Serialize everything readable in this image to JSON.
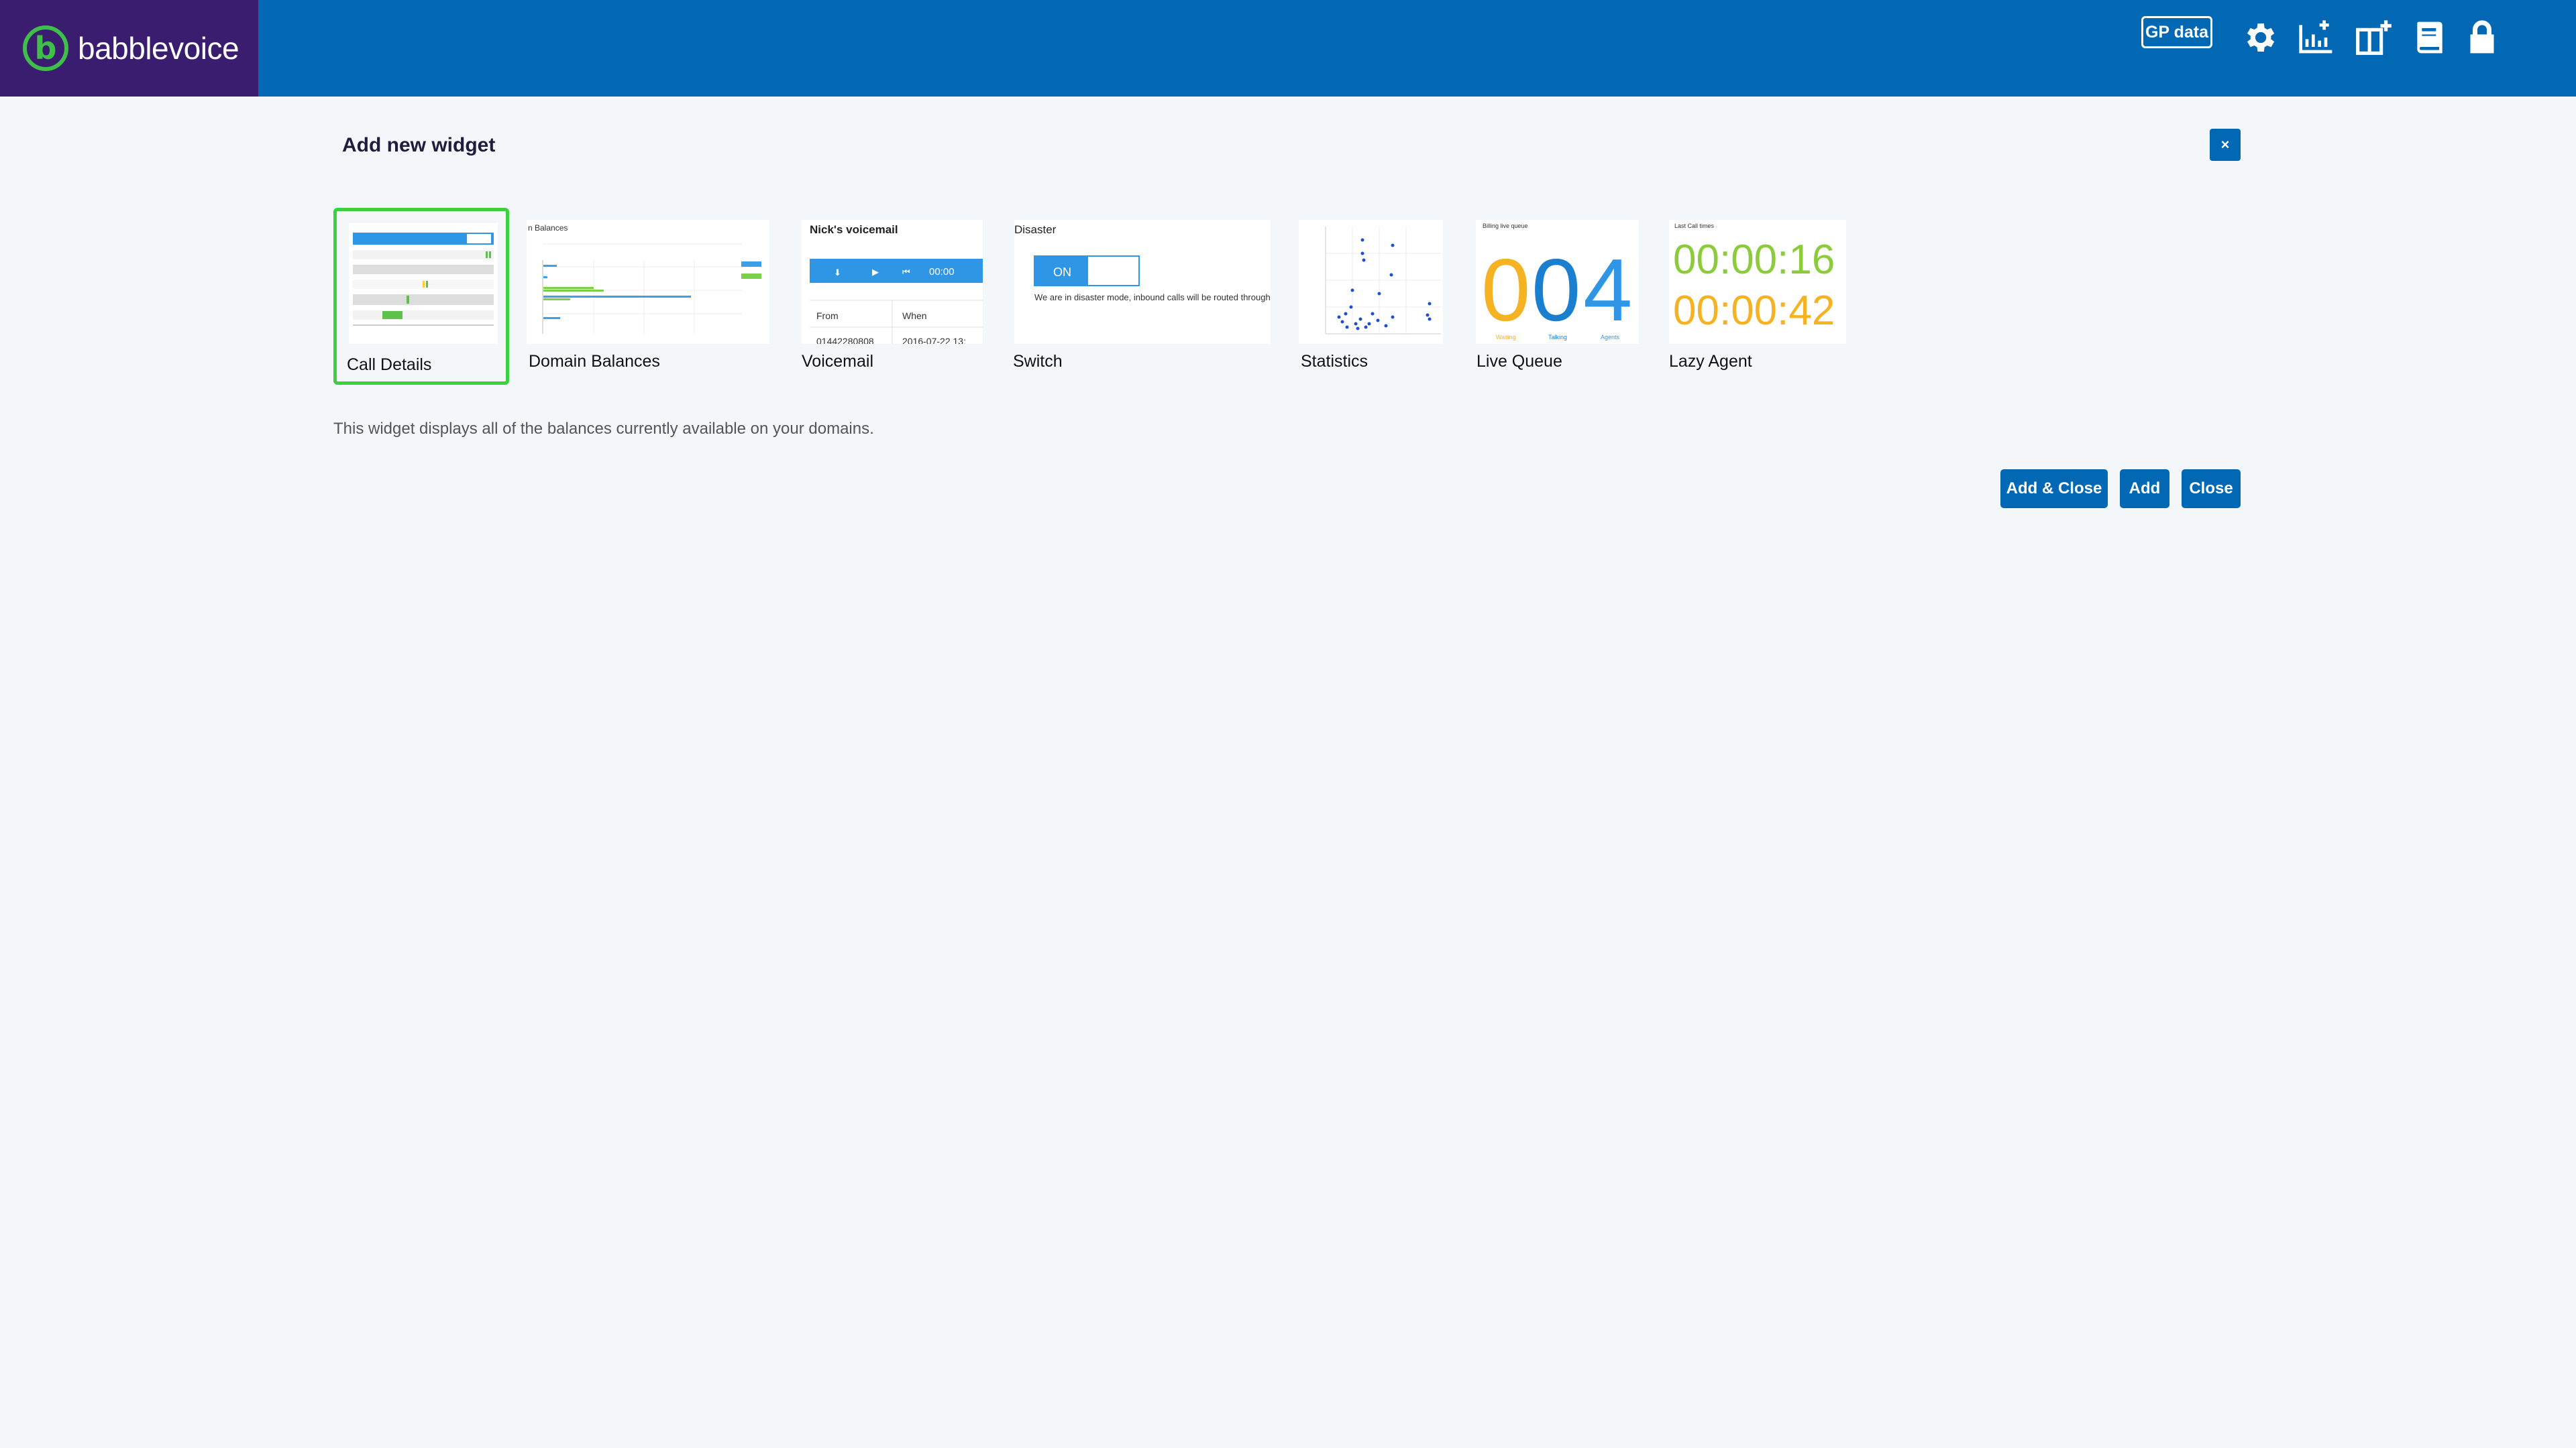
{
  "header": {
    "brand_letter": "b",
    "brand_name": "babblevoice",
    "gp_label": "GP data",
    "icons": [
      "gear-icon",
      "add-chart-icon",
      "add-widget-icon",
      "book-icon",
      "lock-icon"
    ],
    "colors": {
      "bar": "#0368b4",
      "brand_bg": "#3a1d6e",
      "brand_accent": "#3fbf4a"
    }
  },
  "modal": {
    "title": "Add new widget",
    "close_label": "×",
    "widgets": [
      {
        "label": "Call Details",
        "selected": true
      },
      {
        "label": "Domain Balances",
        "thumb_title": "n Balances"
      },
      {
        "label": "Voicemail",
        "thumb_title": "Nick's voicemail",
        "time": "00:00",
        "col_from": "From",
        "col_when": "When",
        "row_number": "01442280808",
        "row_date": "2016-07-22 13:"
      },
      {
        "label": "Switch",
        "thumb_title": "Disaster",
        "toggle_label": "ON",
        "message": "We are in disaster mode, inbound calls will be routed through mobiles."
      },
      {
        "label": "Statistics"
      },
      {
        "label": "Live Queue",
        "thumb_title": "Billing live queue",
        "digits": [
          "0",
          "0",
          "4"
        ],
        "sub_labels": [
          "Waiting",
          "Talking",
          "Agents"
        ]
      },
      {
        "label": "Lazy Agent",
        "thumb_title": "Last Call times",
        "time1": "00:00:16",
        "time2": "00:00:42"
      }
    ],
    "description": "This widget displays all of the balances currently available on your domains.",
    "buttons": {
      "add_close": "Add & Close",
      "add": "Add",
      "close": "Close"
    }
  }
}
